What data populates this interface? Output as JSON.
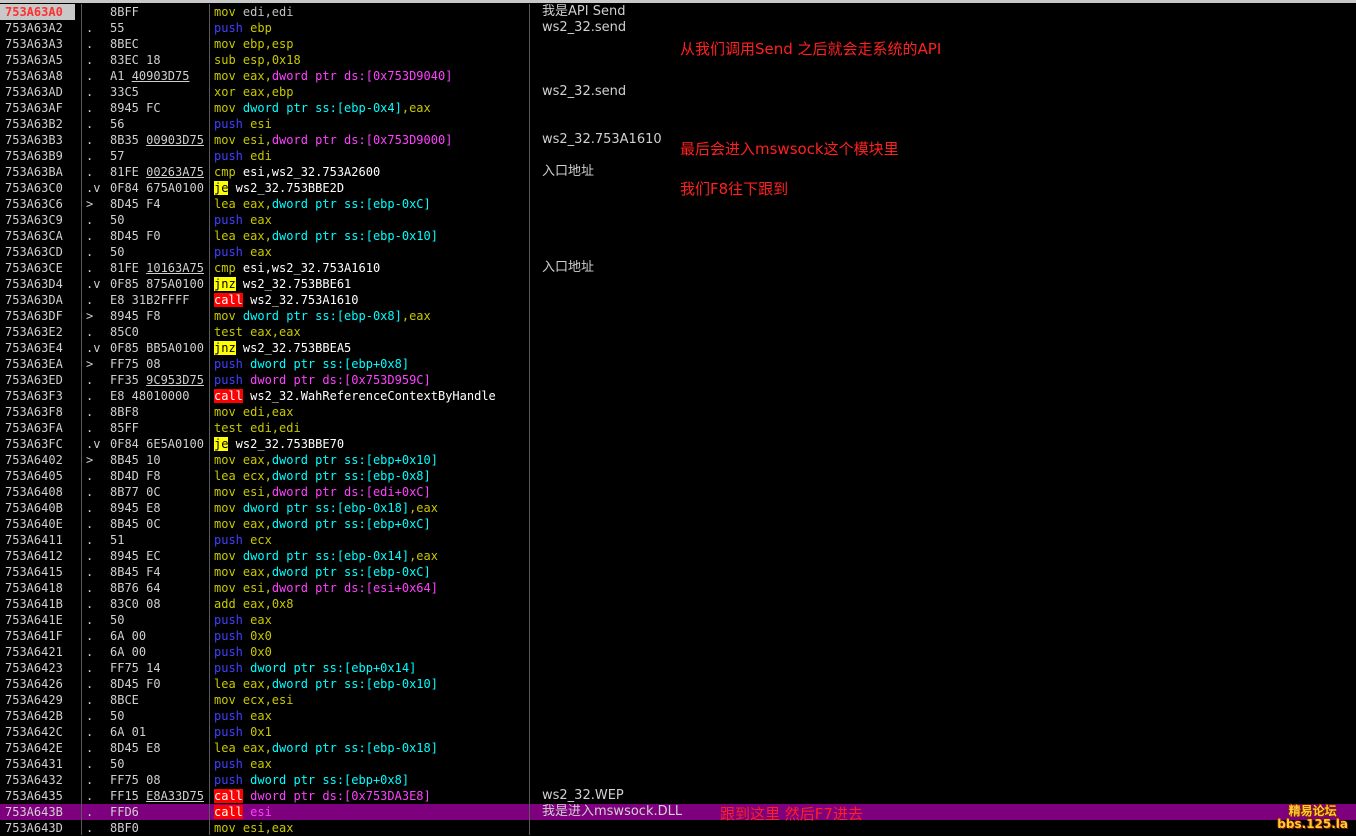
{
  "colors": {
    "background": "#000000",
    "current_row": "#7e007e",
    "note_red": "#ff2020",
    "jump_highlight": "#ffff00",
    "call_highlight": "#ff0000"
  },
  "rows": [
    {
      "addr": "753A63A0",
      "mark": "",
      "hex": "8BFF",
      "mn": "mov",
      "mnType": "norm",
      "ops": [
        {
          "t": " edi,edi",
          "c": "grey"
        }
      ],
      "comment": "我是API Send",
      "selected": true
    },
    {
      "addr": "753A63A2",
      "mark": ".",
      "hex": "55",
      "mn": "push",
      "mnType": "push",
      "ops": [
        {
          "t": " ebp",
          "c": "olive"
        }
      ],
      "comment": "ws2_32.send"
    },
    {
      "addr": "753A63A3",
      "mark": ".",
      "hex": "8BEC",
      "mn": "mov",
      "mnType": "norm",
      "ops": [
        {
          "t": " ebp,esp",
          "c": "olive"
        }
      ]
    },
    {
      "addr": "753A63A5",
      "mark": ".",
      "hex": "83EC 18",
      "mn": "sub",
      "mnType": "norm",
      "ops": [
        {
          "t": " esp,",
          "c": "olive"
        },
        {
          "t": "0x18",
          "c": "olive"
        }
      ]
    },
    {
      "addr": "753A63A8",
      "mark": ".",
      "hex": "A1 40903D75",
      "hexUl": "40903D75",
      "mn": "mov",
      "mnType": "norm",
      "ops": [
        {
          "t": " eax,",
          "c": "olive"
        },
        {
          "t": "dword ptr ds:[0x753D9040]",
          "c": "mag"
        }
      ]
    },
    {
      "addr": "753A63AD",
      "mark": ".",
      "hex": "33C5",
      "mn": "xor",
      "mnType": "norm",
      "ops": [
        {
          "t": " eax,ebp",
          "c": "olive"
        }
      ],
      "comment": "ws2_32.send"
    },
    {
      "addr": "753A63AF",
      "mark": ".",
      "hex": "8945 FC",
      "mn": "mov",
      "mnType": "norm",
      "ops": [
        {
          "t": " dword ptr ss:[ebp-0x4]",
          "c": "cyan"
        },
        {
          "t": ",eax",
          "c": "olive"
        }
      ]
    },
    {
      "addr": "753A63B2",
      "mark": ".",
      "hex": "56",
      "mn": "push",
      "mnType": "push",
      "ops": [
        {
          "t": " esi",
          "c": "olive"
        }
      ]
    },
    {
      "addr": "753A63B3",
      "mark": ".",
      "hex": "8B35 00903D75",
      "hexUl": "00903D75",
      "mn": "mov",
      "mnType": "norm",
      "ops": [
        {
          "t": " esi,",
          "c": "olive"
        },
        {
          "t": "dword ptr ds:[0x753D9000]",
          "c": "mag"
        }
      ],
      "comment": "ws2_32.753A1610"
    },
    {
      "addr": "753A63B9",
      "mark": ".",
      "hex": "57",
      "mn": "push",
      "mnType": "push",
      "ops": [
        {
          "t": " edi",
          "c": "olive"
        }
      ]
    },
    {
      "addr": "753A63BA",
      "mark": ".",
      "hex": "81FE 00263A75",
      "hexUl": "00263A75",
      "mn": "cmp",
      "mnType": "norm",
      "ops": [
        {
          "t": " esi,ws2_32.753A2600",
          "c": "white"
        }
      ],
      "comment": "入口地址"
    },
    {
      "addr": "753A63C0",
      "mark": ".v",
      "hex": "0F84 675A0100",
      "mn": "je",
      "mnType": "jmp",
      "ops": [
        {
          "t": " ws2_32.753BBE2D",
          "c": "white"
        }
      ]
    },
    {
      "addr": "753A63C6",
      "mark": ">",
      "hex": "8D45 F4",
      "mn": "lea",
      "mnType": "norm",
      "ops": [
        {
          "t": " eax,",
          "c": "olive"
        },
        {
          "t": "dword ptr ss:[ebp-0xC]",
          "c": "cyan"
        }
      ]
    },
    {
      "addr": "753A63C9",
      "mark": ".",
      "hex": "50",
      "mn": "push",
      "mnType": "push",
      "ops": [
        {
          "t": " eax",
          "c": "olive"
        }
      ]
    },
    {
      "addr": "753A63CA",
      "mark": ".",
      "hex": "8D45 F0",
      "mn": "lea",
      "mnType": "norm",
      "ops": [
        {
          "t": " eax,",
          "c": "olive"
        },
        {
          "t": "dword ptr ss:[ebp-0x10]",
          "c": "cyan"
        }
      ]
    },
    {
      "addr": "753A63CD",
      "mark": ".",
      "hex": "50",
      "mn": "push",
      "mnType": "push",
      "ops": [
        {
          "t": " eax",
          "c": "olive"
        }
      ]
    },
    {
      "addr": "753A63CE",
      "mark": ".",
      "hex": "81FE 10163A75",
      "hexUl": "10163A75",
      "mn": "cmp",
      "mnType": "norm",
      "ops": [
        {
          "t": " esi,ws2_32.753A1610",
          "c": "white"
        }
      ],
      "comment": "入口地址"
    },
    {
      "addr": "753A63D4",
      "mark": ".v",
      "hex": "0F85 875A0100",
      "mn": "jnz",
      "mnType": "jmp",
      "ops": [
        {
          "t": " ws2_32.753BBE61",
          "c": "white"
        }
      ]
    },
    {
      "addr": "753A63DA",
      "mark": ".",
      "hex": "E8 31B2FFFF",
      "mn": "call",
      "mnType": "call",
      "ops": [
        {
          "t": " ws2_32.753A1610",
          "c": "white"
        }
      ]
    },
    {
      "addr": "753A63DF",
      "mark": ">",
      "hex": "8945 F8",
      "mn": "mov",
      "mnType": "norm",
      "ops": [
        {
          "t": " dword ptr ss:[ebp-0x8]",
          "c": "cyan"
        },
        {
          "t": ",eax",
          "c": "olive"
        }
      ]
    },
    {
      "addr": "753A63E2",
      "mark": ".",
      "hex": "85C0",
      "mn": "test",
      "mnType": "norm",
      "ops": [
        {
          "t": " eax,eax",
          "c": "olive"
        }
      ]
    },
    {
      "addr": "753A63E4",
      "mark": ".v",
      "hex": "0F85 BB5A0100",
      "mn": "jnz",
      "mnType": "jmp",
      "ops": [
        {
          "t": " ws2_32.753BBEA5",
          "c": "white"
        }
      ]
    },
    {
      "addr": "753A63EA",
      "mark": ">",
      "hex": "FF75 08",
      "mn": "push",
      "mnType": "push",
      "ops": [
        {
          "t": " dword ptr ss:[ebp+0x8]",
          "c": "cyan"
        }
      ]
    },
    {
      "addr": "753A63ED",
      "mark": ".",
      "hex": "FF35 9C953D75",
      "hexUl": "9C953D75",
      "mn": "push",
      "mnType": "push",
      "ops": [
        {
          "t": " dword ptr ds:[0x753D959C]",
          "c": "mag"
        }
      ]
    },
    {
      "addr": "753A63F3",
      "mark": ".",
      "hex": "E8 48010000",
      "mn": "call",
      "mnType": "call",
      "ops": [
        {
          "t": " ws2_32.WahReferenceContextByHandle",
          "c": "white"
        }
      ]
    },
    {
      "addr": "753A63F8",
      "mark": ".",
      "hex": "8BF8",
      "mn": "mov",
      "mnType": "norm",
      "ops": [
        {
          "t": " edi,eax",
          "c": "olive"
        }
      ]
    },
    {
      "addr": "753A63FA",
      "mark": ".",
      "hex": "85FF",
      "mn": "test",
      "mnType": "norm",
      "ops": [
        {
          "t": " edi,edi",
          "c": "olive"
        }
      ]
    },
    {
      "addr": "753A63FC",
      "mark": ".v",
      "hex": "0F84 6E5A0100",
      "mn": "je",
      "mnType": "jmp",
      "ops": [
        {
          "t": " ws2_32.753BBE70",
          "c": "white"
        }
      ]
    },
    {
      "addr": "753A6402",
      "mark": ">",
      "hex": "8B45 10",
      "mn": "mov",
      "mnType": "norm",
      "ops": [
        {
          "t": " eax,",
          "c": "olive"
        },
        {
          "t": "dword ptr ss:[ebp+0x10]",
          "c": "cyan"
        }
      ]
    },
    {
      "addr": "753A6405",
      "mark": ".",
      "hex": "8D4D F8",
      "mn": "lea",
      "mnType": "norm",
      "ops": [
        {
          "t": " ecx,",
          "c": "olive"
        },
        {
          "t": "dword ptr ss:[ebp-0x8]",
          "c": "cyan"
        }
      ]
    },
    {
      "addr": "753A6408",
      "mark": ".",
      "hex": "8B77 0C",
      "mn": "mov",
      "mnType": "norm",
      "ops": [
        {
          "t": " esi,",
          "c": "olive"
        },
        {
          "t": "dword ptr ds:[edi+0xC]",
          "c": "mag"
        }
      ]
    },
    {
      "addr": "753A640B",
      "mark": ".",
      "hex": "8945 E8",
      "mn": "mov",
      "mnType": "norm",
      "ops": [
        {
          "t": " dword ptr ss:[ebp-0x18]",
          "c": "cyan"
        },
        {
          "t": ",eax",
          "c": "olive"
        }
      ]
    },
    {
      "addr": "753A640E",
      "mark": ".",
      "hex": "8B45 0C",
      "mn": "mov",
      "mnType": "norm",
      "ops": [
        {
          "t": " eax,",
          "c": "olive"
        },
        {
          "t": "dword ptr ss:[ebp+0xC]",
          "c": "cyan"
        }
      ]
    },
    {
      "addr": "753A6411",
      "mark": ".",
      "hex": "51",
      "mn": "push",
      "mnType": "push",
      "ops": [
        {
          "t": " ecx",
          "c": "olive"
        }
      ]
    },
    {
      "addr": "753A6412",
      "mark": ".",
      "hex": "8945 EC",
      "mn": "mov",
      "mnType": "norm",
      "ops": [
        {
          "t": " dword ptr ss:[ebp-0x14]",
          "c": "cyan"
        },
        {
          "t": ",eax",
          "c": "olive"
        }
      ]
    },
    {
      "addr": "753A6415",
      "mark": ".",
      "hex": "8B45 F4",
      "mn": "mov",
      "mnType": "norm",
      "ops": [
        {
          "t": " eax,",
          "c": "olive"
        },
        {
          "t": "dword ptr ss:[ebp-0xC]",
          "c": "cyan"
        }
      ]
    },
    {
      "addr": "753A6418",
      "mark": ".",
      "hex": "8B76 64",
      "mn": "mov",
      "mnType": "norm",
      "ops": [
        {
          "t": " esi,",
          "c": "olive"
        },
        {
          "t": "dword ptr ds:[esi+0x64]",
          "c": "mag"
        }
      ]
    },
    {
      "addr": "753A641B",
      "mark": ".",
      "hex": "83C0 08",
      "mn": "add",
      "mnType": "norm",
      "ops": [
        {
          "t": " eax,",
          "c": "olive"
        },
        {
          "t": "0x8",
          "c": "olive"
        }
      ]
    },
    {
      "addr": "753A641E",
      "mark": ".",
      "hex": "50",
      "mn": "push",
      "mnType": "push",
      "ops": [
        {
          "t": " eax",
          "c": "olive"
        }
      ]
    },
    {
      "addr": "753A641F",
      "mark": ".",
      "hex": "6A 00",
      "mn": "push",
      "mnType": "push",
      "ops": [
        {
          "t": " 0x0",
          "c": "olive"
        }
      ]
    },
    {
      "addr": "753A6421",
      "mark": ".",
      "hex": "6A 00",
      "mn": "push",
      "mnType": "push",
      "ops": [
        {
          "t": " 0x0",
          "c": "olive"
        }
      ]
    },
    {
      "addr": "753A6423",
      "mark": ".",
      "hex": "FF75 14",
      "mn": "push",
      "mnType": "push",
      "ops": [
        {
          "t": " dword ptr ss:[ebp+0x14]",
          "c": "cyan"
        }
      ]
    },
    {
      "addr": "753A6426",
      "mark": ".",
      "hex": "8D45 F0",
      "mn": "lea",
      "mnType": "norm",
      "ops": [
        {
          "t": " eax,",
          "c": "olive"
        },
        {
          "t": "dword ptr ss:[ebp-0x10]",
          "c": "cyan"
        }
      ]
    },
    {
      "addr": "753A6429",
      "mark": ".",
      "hex": "8BCE",
      "mn": "mov",
      "mnType": "norm",
      "ops": [
        {
          "t": " ecx,esi",
          "c": "olive"
        }
      ]
    },
    {
      "addr": "753A642B",
      "mark": ".",
      "hex": "50",
      "mn": "push",
      "mnType": "push",
      "ops": [
        {
          "t": " eax",
          "c": "olive"
        }
      ]
    },
    {
      "addr": "753A642C",
      "mark": ".",
      "hex": "6A 01",
      "mn": "push",
      "mnType": "push",
      "ops": [
        {
          "t": " 0x1",
          "c": "olive"
        }
      ]
    },
    {
      "addr": "753A642E",
      "mark": ".",
      "hex": "8D45 E8",
      "mn": "lea",
      "mnType": "norm",
      "ops": [
        {
          "t": " eax,",
          "c": "olive"
        },
        {
          "t": "dword ptr ss:[ebp-0x18]",
          "c": "cyan"
        }
      ]
    },
    {
      "addr": "753A6431",
      "mark": ".",
      "hex": "50",
      "mn": "push",
      "mnType": "push",
      "ops": [
        {
          "t": " eax",
          "c": "olive"
        }
      ]
    },
    {
      "addr": "753A6432",
      "mark": ".",
      "hex": "FF75 08",
      "mn": "push",
      "mnType": "push",
      "ops": [
        {
          "t": " dword ptr ss:[ebp+0x8]",
          "c": "cyan"
        }
      ]
    },
    {
      "addr": "753A6435",
      "mark": ".",
      "hex": "FF15 E8A33D75",
      "hexUl": "E8A33D75",
      "mn": "call",
      "mnType": "call",
      "ops": [
        {
          "t": " dword ptr ds:[0x753DA3E8]",
          "c": "mag"
        }
      ],
      "comment": "ws2_32.WEP"
    },
    {
      "addr": "753A643B",
      "mark": ".",
      "hex": "FFD6",
      "mn": "call",
      "mnType": "call",
      "ops": [
        {
          "t": " esi",
          "c": "mag"
        }
      ],
      "comment": "我是进入mswsock.DLL",
      "current": true
    },
    {
      "addr": "753A643D",
      "mark": ".",
      "hex": "8BF0",
      "mn": "mov",
      "mnType": "norm",
      "ops": [
        {
          "t": " esi,eax",
          "c": "olive"
        }
      ]
    }
  ],
  "notes": {
    "n1": "从我们调用Send 之后就会走系统的API",
    "n2": "最后会进入mswsock这个模块里",
    "n3": "我们F8往下跟到",
    "n4": "跟到这里 然后F7进去"
  },
  "watermark": {
    "line1": "精易论坛",
    "line2": "bbs.125.la"
  }
}
